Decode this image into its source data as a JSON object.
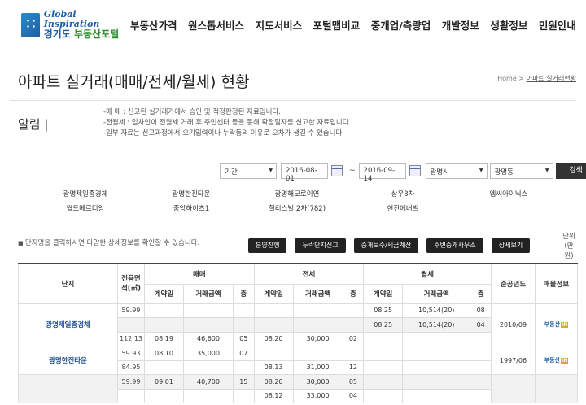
{
  "logo": {
    "en": "Global Inspiration",
    "ko_prefix": "경기도 ",
    "ko_brand": "부동산포털"
  },
  "menu": [
    "부동산가격",
    "원스톱서비스",
    "지도서비스",
    "포털맵비교",
    "중개업/측량업",
    "개발정보",
    "생활정보",
    "민원안내"
  ],
  "page": {
    "title": "아파트 실거래(매매/전세/월세) 현황",
    "breadcrumb_home": "Home >",
    "breadcrumb_current": "아파트 실거래현황"
  },
  "notice": {
    "title": "알림 |",
    "lines": [
      "-매 매 : 신고된 실거래가에서 승인 및 적정판정된 자료입니다.",
      "-전월세 : 임차인이 전월세 거래 후 주민센터 등을 통해 확정일자를 신고한 자료입니다.",
      "-일부 자료는 신고과정에서 오기입력이나 누락등의 이유로 오차가 생길 수 있습니다."
    ]
  },
  "filters": {
    "period": "기간",
    "start_date": "2016-08-01",
    "tilde": "~",
    "end_date": "2016-09-14",
    "city": "광명시",
    "dong": "광명동",
    "search": "검색"
  },
  "complexes": [
    "광명제일종경체",
    "광명한진타운",
    "광명해모로이연",
    "상우3차",
    "엠씨아이닉스",
    "월드메르디앙",
    "중앙하이츠1",
    "철리스빌 2차(782)",
    "현진에버빌"
  ],
  "info_text": "단지명을 클릭하시면 다양한 상세정보를 확인할 수 있습니다.",
  "actions": [
    "분양진행",
    "누락단지신고",
    "중개보수/세금계산",
    "주변중개사무소",
    "상세보기"
  ],
  "unit_label": "단위(만원)",
  "table": {
    "headers": {
      "complex": "단지",
      "area": "전용면적(㎡)",
      "sale": "매매",
      "jeonse": "전세",
      "monthly": "월세",
      "year": "준공년도",
      "info": "매물정보"
    },
    "sub": {
      "date": "계약일",
      "amount": "거래금액",
      "floor": "층"
    },
    "badge_text": "부동산",
    "badge_mark": "IN",
    "groups": [
      {
        "name": "광명제일종경체",
        "year": "2010/09",
        "rows": [
          {
            "area": "59.99",
            "s": [
              "",
              "",
              ""
            ],
            "j": [
              "",
              "",
              ""
            ],
            "m": [
              "08.25",
              "10,514(20)",
              "08"
            ],
            "shade": false
          },
          {
            "area": "",
            "s": [
              "",
              "",
              ""
            ],
            "j": [
              "",
              "",
              ""
            ],
            "m": [
              "08.25",
              "10,514(20)",
              "04"
            ],
            "shade": true
          },
          {
            "area": "112.13",
            "s": [
              "08.19",
              "46,600",
              "05"
            ],
            "j": [
              "08.20",
              "30,000",
              "02"
            ],
            "m": [
              "",
              "",
              ""
            ],
            "shade": false
          }
        ]
      },
      {
        "name": "광명한진타운",
        "year": "1997/06",
        "rows": [
          {
            "area": "59.93",
            "s": [
              "08.10",
              "35,000",
              "07"
            ],
            "j": [
              "",
              "",
              ""
            ],
            "m": [
              "",
              "",
              ""
            ],
            "shade": false
          },
          {
            "area": "84.95",
            "s": [
              "",
              "",
              ""
            ],
            "j": [
              "08.13",
              "31,000",
              "12"
            ],
            "m": [
              "",
              "",
              ""
            ],
            "shade": false
          }
        ]
      },
      {
        "name": "",
        "year": "",
        "rows": [
          {
            "area": "59.99",
            "s": [
              "09.01",
              "40,700",
              "15"
            ],
            "j": [
              "08.20",
              "30,000",
              "05"
            ],
            "m": [
              "",
              "",
              ""
            ],
            "shade": true
          },
          {
            "area": "",
            "s": [
              "",
              "",
              ""
            ],
            "j": [
              "08.12",
              "33,000",
              "04"
            ],
            "m": [
              "",
              "",
              ""
            ],
            "shade": false
          }
        ]
      }
    ]
  }
}
